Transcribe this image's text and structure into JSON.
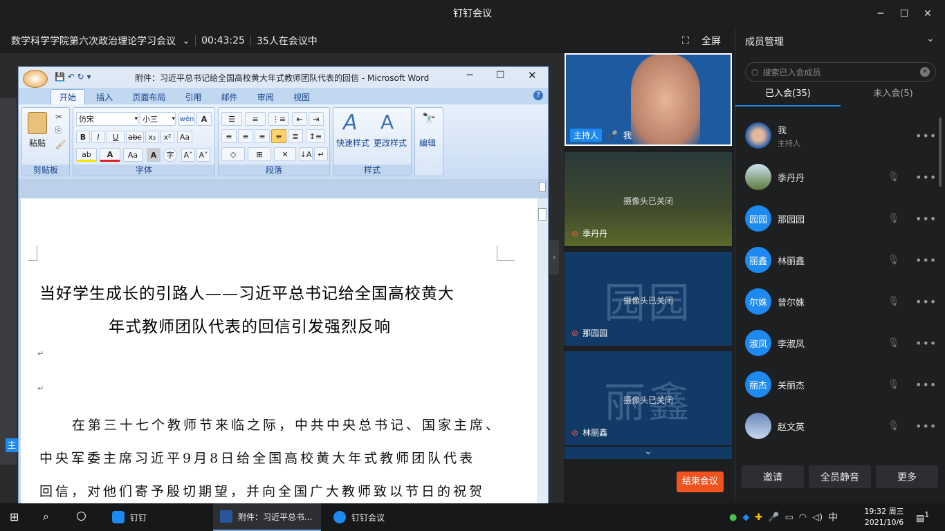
{
  "app": {
    "title": "钉钉会议"
  },
  "window": {
    "minimize": "─",
    "maximize": "☐",
    "close": "✕"
  },
  "meeting": {
    "name": "数学科学学院第六次政治理论学习会议",
    "duration": "00:43:25",
    "attendees": "35人在会议中",
    "fullscreen": "全屏",
    "end": "结束会议",
    "host_tag": "主"
  },
  "word": {
    "title": "附件：习近平总书记给全国高校黄大年式教师团队代表的回信 - Microsoft Word",
    "tabs": [
      "开始",
      "插入",
      "页面布局",
      "引用",
      "邮件",
      "审阅",
      "视图"
    ],
    "font_name": "仿宋",
    "font_size": "小三",
    "groups": {
      "clipboard": "剪贴板",
      "font": "字体",
      "paragraph": "段落",
      "styles": "样式",
      "edit": "编辑"
    },
    "paste": "粘贴",
    "quick_style": "快速样式",
    "change_style": "更改样式",
    "edit_btn": "编辑",
    "doc": {
      "title_line1": "当好学生成长的引路人——习近平总书记给全国高校黄大",
      "title_line2": "年式教师团队代表的回信引发强烈反响",
      "para_mark": "↵",
      "para_line1": "在第三十七个教师节来临之际，中共中央总书记、国家主席、",
      "para_line2": "中央军委主席习近平9月8日给全国高校黄大年式教师团队代表",
      "para_line3": "回信，对他们寄予殷切期望，并向全国广大教师致以节日的祝贺"
    }
  },
  "tiles": {
    "host": {
      "role": "主持人",
      "name": "我"
    },
    "camera_off": "摄像头已关闭",
    "t2": {
      "name": "季丹丹"
    },
    "t3": {
      "name": "那园园",
      "big": "园园"
    },
    "t4": {
      "name": "林丽鑫",
      "big": "丽鑫"
    }
  },
  "sidebar": {
    "title": "成员管理",
    "search_placeholder": "搜索已入会成员",
    "tab_joined": "已入会(35)",
    "tab_notjoined": "未入会(5)",
    "members": [
      {
        "name": "我",
        "sub": "主持人",
        "avatar": "photo"
      },
      {
        "name": "季丹丹",
        "avatar": "photo"
      },
      {
        "name": "那园园",
        "avatar": "园园"
      },
      {
        "name": "林丽鑫",
        "avatar": "丽鑫"
      },
      {
        "name": "曾尔姝",
        "avatar": "尔姝"
      },
      {
        "name": "李淑凤",
        "avatar": "淑凤"
      },
      {
        "name": "关丽杰",
        "avatar": "丽杰"
      },
      {
        "name": "赵文英",
        "avatar": "photo"
      }
    ],
    "more": "•••",
    "buttons": {
      "invite": "邀请",
      "mute_all": "全员静音",
      "more": "更多"
    }
  },
  "taskbar": {
    "apps": [
      "钉钉",
      "附件：习近平总书...",
      "钉钉会议"
    ],
    "ime": "中",
    "time": "19:32 周三",
    "date": "2021/10/6",
    "notif": "1"
  },
  "colors": {
    "accent": "#1c8af0",
    "end_button": "#f0531f",
    "tile_bg": "#123a66"
  }
}
